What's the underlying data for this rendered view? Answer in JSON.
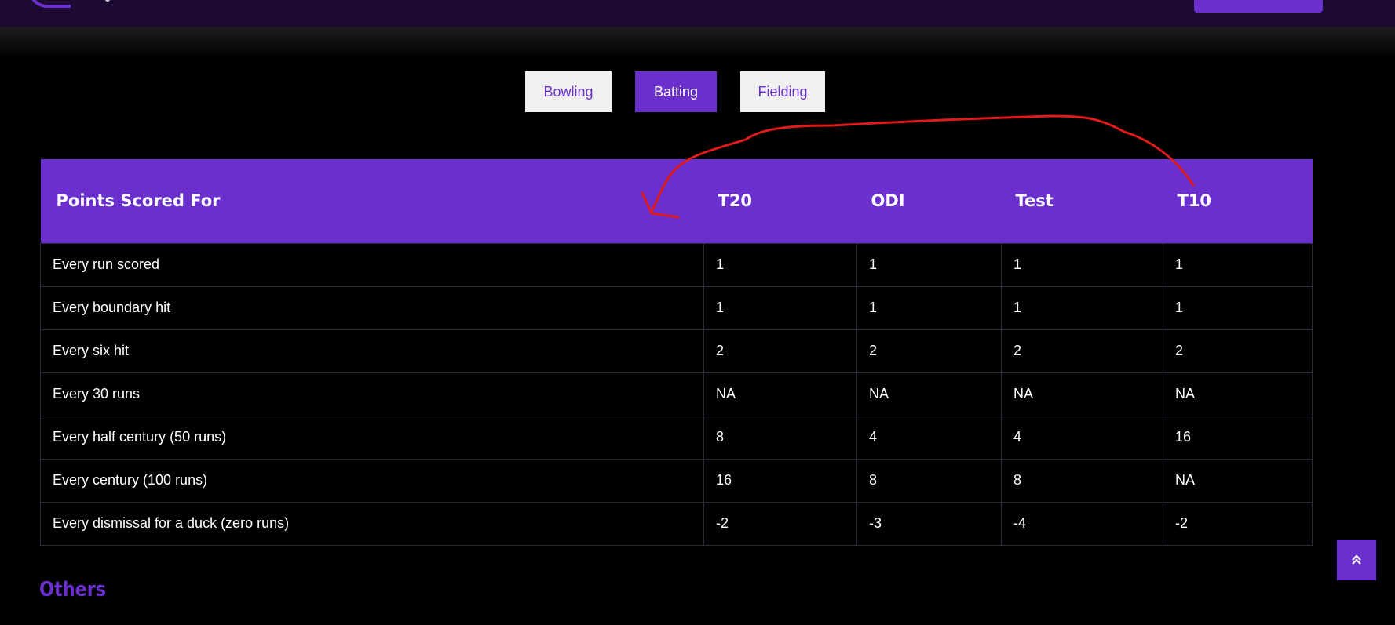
{
  "tabs": [
    {
      "label": "Bowling",
      "active": false
    },
    {
      "label": "Batting",
      "active": true
    },
    {
      "label": "Fielding",
      "active": false
    }
  ],
  "table": {
    "headers": [
      "Points Scored For",
      "T20",
      "ODI",
      "Test",
      "T10"
    ],
    "rows": [
      [
        "Every run scored",
        "1",
        "1",
        "1",
        "1"
      ],
      [
        "Every boundary hit",
        "1",
        "1",
        "1",
        "1"
      ],
      [
        "Every six hit",
        "2",
        "2",
        "2",
        "2"
      ],
      [
        "Every 30 runs",
        "NA",
        "NA",
        "NA",
        "NA"
      ],
      [
        "Every half century (50 runs)",
        "8",
        "4",
        "4",
        "16"
      ],
      [
        "Every century (100 runs)",
        "16",
        "8",
        "8",
        "NA"
      ],
      [
        "Every dismissal for a duck (zero runs)",
        "-2",
        "-3",
        "-4",
        "-2"
      ]
    ]
  },
  "section": {
    "others_title": "Others"
  },
  "icons": {
    "scroll_top": "double-chevron-up-icon"
  },
  "colors": {
    "accent": "#6a2fcc",
    "annotation": "#e01b1b",
    "background": "#000000"
  }
}
